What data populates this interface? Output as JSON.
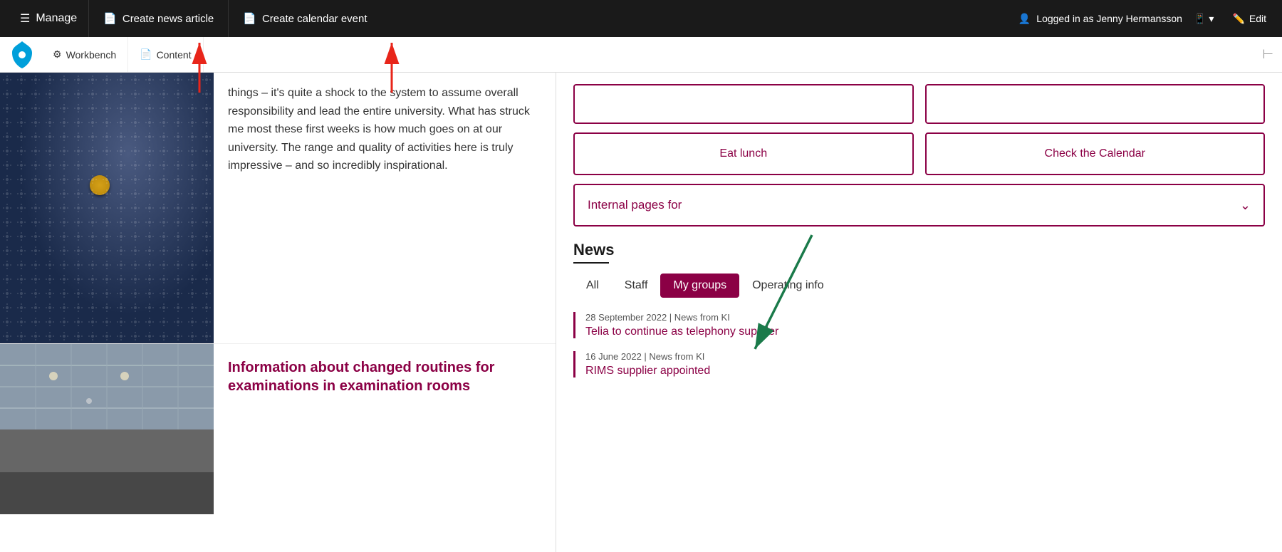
{
  "adminBar": {
    "manage_label": "Manage",
    "create_news_label": "Create news article",
    "create_calendar_label": "Create calendar event",
    "logged_in_label": "Logged in as Jenny Hermansson",
    "edit_label": "Edit"
  },
  "toolbar": {
    "workbench_label": "Workbench",
    "content_label": "Content"
  },
  "article1": {
    "text": "things – it's quite a shock to the system to assume overall responsibility and lead the entire university. What has struck me most these first weeks is how much goes on at our university. The range and quality of activities here is truly impressive – and so incredibly inspirational."
  },
  "article2": {
    "title": "Information about changed routines for examinations in examination rooms"
  },
  "rightCol": {
    "btn1_label": "Eat lunch",
    "btn2_label": "Check the Calendar",
    "internal_pages_label": "Internal pages for",
    "news_title": "News",
    "tab_all": "All",
    "tab_staff": "Staff",
    "tab_mygroups": "My groups",
    "tab_operating": "Operating info",
    "news_items": [
      {
        "meta": "28 September 2022 | News from KI",
        "link": "Telia to continue as telephony supplier"
      },
      {
        "meta": "16 June 2022 | News from KI",
        "link": "RIMS supplier appointed"
      }
    ]
  },
  "colors": {
    "maroon": "#8b0045",
    "darkbg": "#1a1a1a"
  }
}
